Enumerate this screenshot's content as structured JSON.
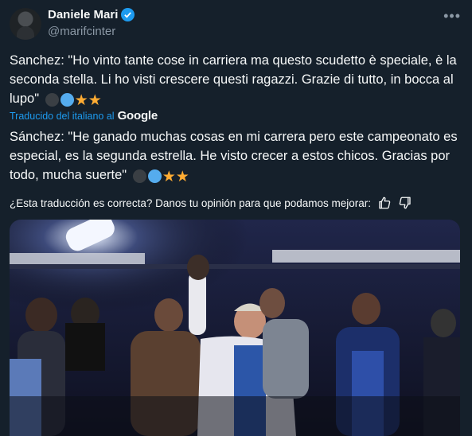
{
  "author": {
    "name": "Daniele Mari",
    "handle": "@marifcinter",
    "verified_icon": "verified-badge-icon",
    "more_icon": "more-icon"
  },
  "tweet": {
    "original_text": "Sanchez: \"Ho vinto tante cose in carriera ma questo scudetto è speciale, è la seconda stella. Li ho visti crescere questi ragazzi. Grazie di tutto, in bocca al lupo\"",
    "translated_by": "Traducido del italiano al",
    "translator": "Google",
    "translated_text": "Sánchez: \"He ganado muchas cosas en mi carrera pero este campeonato es especial, es la segunda estrella. He visto crecer a estos chicos. Gracias por todo, mucha suerte\"",
    "emojis": [
      "black-circle",
      "blue-circle",
      "star",
      "star"
    ]
  },
  "feedback": {
    "question": "¿Esta traducción es correcta? Danos tu opinión para que podamos mejorar:",
    "thumbs_up_icon": "thumbs-up-icon",
    "thumbs_down_icon": "thumbs-down-icon"
  },
  "media": {
    "description_icon": "photo"
  },
  "colors": {
    "background": "#15202b",
    "accent": "#1d9bf0",
    "secondary_text": "#8b98a5",
    "star": "#ffac33"
  }
}
